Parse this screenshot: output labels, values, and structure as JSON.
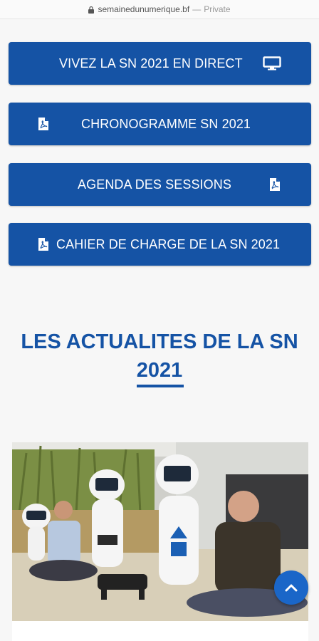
{
  "browser": {
    "url": "semainedunumerique.bf",
    "separator": "—",
    "privacy": "Private"
  },
  "buttons": [
    {
      "label": "VIVEZ LA SN 2021 EN DIRECT",
      "icon": "desktop-icon"
    },
    {
      "label": "CHRONOGRAMME SN 2021",
      "icon": "pdf-file-icon"
    },
    {
      "label": "AGENDA DES SESSIONS",
      "icon": "pdf-file-icon"
    },
    {
      "label": "CAHIER DE CHARGE DE LA SN 2021",
      "icon": "pdf-file-icon"
    }
  ],
  "news": {
    "title_line1": "LES ACTUALITES DE LA SN",
    "title_line2": "2021",
    "photo_alt": "Two men seated on the floor among white service robots"
  },
  "scroll_top": {
    "icon": "chevron-up-icon"
  },
  "colors": {
    "primary": "#1553a5",
    "scroll_button": "#1a66c8",
    "background": "#f7f7f7"
  }
}
